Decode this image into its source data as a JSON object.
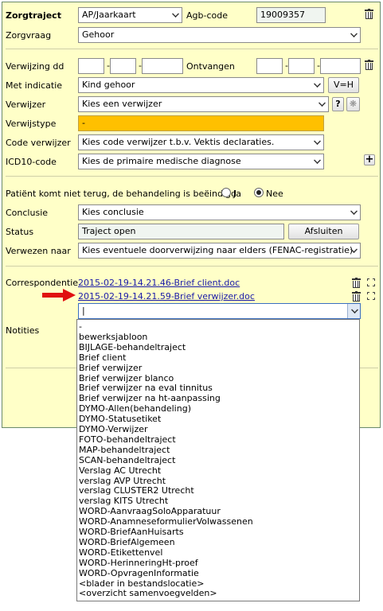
{
  "header": {
    "title": "Zorgtraject",
    "traject_select": "AP/Jaarkaart",
    "agb_label": "Agb-code",
    "agb_value": "19009357"
  },
  "zorgvraag": {
    "label": "Zorgvraag",
    "value": "Gehoor"
  },
  "verwijzing": {
    "label": "Verwijzing dd",
    "sep": "-",
    "ontvangen_label": "Ontvangen"
  },
  "indicatie": {
    "label": "Met indicatie",
    "value": "Kind gehoor",
    "button": "V=H"
  },
  "verwijzer": {
    "label": "Verwijzer",
    "value": "Kies een verwijzer",
    "help": "?"
  },
  "verwijstype": {
    "label": "Verwijstype",
    "value": "-"
  },
  "code_verwijzer": {
    "label": "Code verwijzer",
    "value": "Kies code verwijzer t.b.v. Vektis declaraties."
  },
  "icd10": {
    "label": "ICD10-code",
    "value": "Kies de primaire medische diagnose",
    "add": "+"
  },
  "patient_question": {
    "label": "Patiënt komt niet terug, de behandeling is beëindigd",
    "ja": "Ja",
    "nee": "Nee",
    "selected": "Nee"
  },
  "conclusie": {
    "label": "Conclusie",
    "value": "Kies conclusie"
  },
  "status": {
    "label": "Status",
    "value": "Traject open",
    "button": "Afsluiten"
  },
  "verwezen": {
    "label": "Verwezen naar",
    "value": "Kies eventuele doorverwijzing naar elders (FENAC-registratie)"
  },
  "correspondentie": {
    "label": "Correspondentie",
    "files": [
      "2015-02-19-14.21.46-Brief client.doc",
      "2015-02-19-14.21.59-Brief verwijzer.doc"
    ],
    "select_value": "|"
  },
  "notities": {
    "label": "Notities"
  },
  "dropdown_options": [
    "-",
    "bewerksjabloon",
    "BIJLAGE-behandeltraject",
    "Brief client",
    "Brief verwijzer",
    "Brief verwijzer blanco",
    "Brief verwijzer na eval tinnitus",
    "Brief verwijzer na ht-aanpassing",
    "DYMO-Allen(behandeling)",
    "DYMO-Statusetiket",
    "DYMO-Verwijzer",
    "FOTO-behandeltraject",
    "MAP-behandeltraject",
    "SCAN-behandeltraject",
    "Verslag AC Utrecht",
    "verslag AVP Utrecht",
    "verslag CLUSTER2 Utrecht",
    "verslag KITS Utrecht",
    "WORD-AanvraagSoloApparatuur",
    "WORD-AnamneseformulierVolwassenen",
    "WORD-BriefAanHuisarts",
    "WORD-BriefAlgemeen",
    "WORD-Etikettenvel",
    "WORD-HerinneringHt-proef",
    "WORD-OpvragenInformatie",
    "<blader in bestandslocatie>",
    "<overzicht samenvoegvelden>"
  ],
  "colors": {
    "panel_bg": "#ffffc8",
    "verwijstype_bg": "#ffc000",
    "link": "#1a1aa8",
    "arrow": "#e01010"
  },
  "icons": [
    "trash-icon",
    "expand-icon",
    "help-icon",
    "asterisk-icon",
    "plus-icon",
    "red-arrow-icon"
  ]
}
